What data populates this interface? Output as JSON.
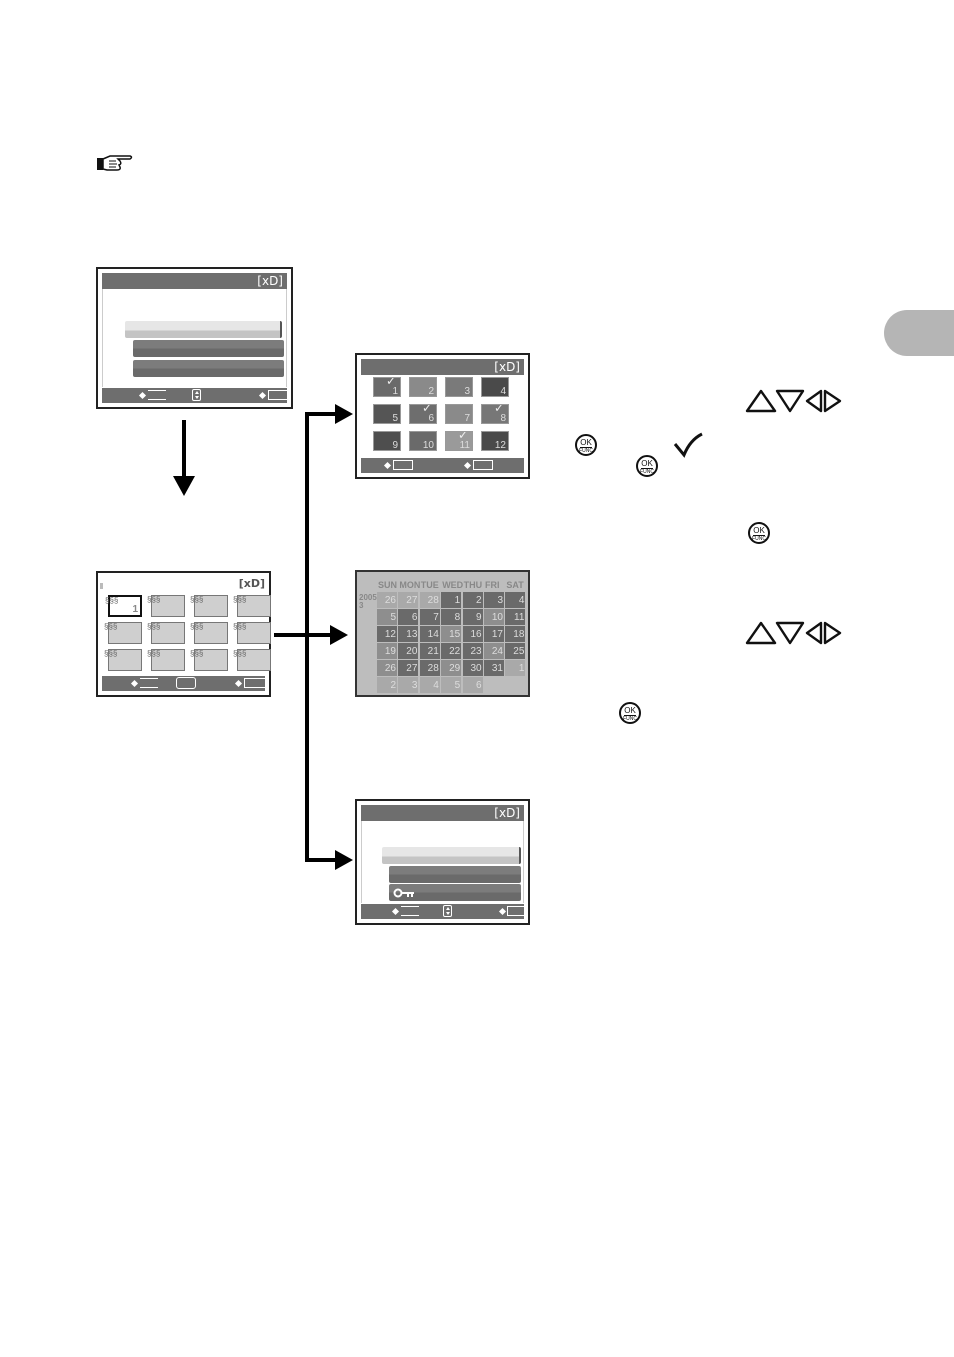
{
  "page": {
    "side_tab": {
      "color": "#b5b5b5"
    },
    "reference_icon": "pointing-hand-icon"
  },
  "screens": {
    "menu_top": {
      "media_label": "[xD]",
      "menu_items": [
        {
          "label": "",
          "state": "selected"
        },
        {
          "label": "",
          "state": "normal"
        },
        {
          "label": "",
          "state": "normal"
        }
      ],
      "footer": {
        "back": "",
        "nav_icon": "up-down-icon",
        "ok": ""
      }
    },
    "album_index": {
      "media_label": "[xD]",
      "albums": [
        {
          "number": "1",
          "selected": true
        },
        {
          "number": "",
          "selected": false
        },
        {
          "number": "",
          "selected": false
        },
        {
          "number": "",
          "selected": false
        },
        {
          "number": "",
          "selected": false
        },
        {
          "number": "",
          "selected": false
        },
        {
          "number": "",
          "selected": false
        },
        {
          "number": "",
          "selected": false
        },
        {
          "number": "",
          "selected": false
        },
        {
          "number": "",
          "selected": false
        },
        {
          "number": "",
          "selected": false
        },
        {
          "number": "",
          "selected": false
        }
      ],
      "footer": {
        "back": "",
        "nav_icon": "four-way-icon",
        "ok": ""
      }
    },
    "thumbnail_select": {
      "media_label": "[xD]",
      "thumbnails": [
        {
          "number": "1",
          "checked": true,
          "tone": "#6a6a6a"
        },
        {
          "number": "2",
          "checked": false,
          "tone": "#8a8a8a"
        },
        {
          "number": "3",
          "checked": false,
          "tone": "#7a7a7a"
        },
        {
          "number": "4",
          "checked": false,
          "tone": "#4a4a4a"
        },
        {
          "number": "5",
          "checked": false,
          "tone": "#555555"
        },
        {
          "number": "6",
          "checked": true,
          "tone": "#6e6e6e"
        },
        {
          "number": "7",
          "checked": false,
          "tone": "#8a8a8a"
        },
        {
          "number": "8",
          "checked": true,
          "tone": "#777777"
        },
        {
          "number": "9",
          "checked": false,
          "tone": "#4e4e4e"
        },
        {
          "number": "10",
          "checked": false,
          "tone": "#6a6a6a"
        },
        {
          "number": "11",
          "checked": true,
          "tone": "#9a9a9a"
        },
        {
          "number": "12",
          "checked": false,
          "tone": "#4a4a4a"
        }
      ],
      "footer": {
        "left": "",
        "right": ""
      }
    },
    "calendar": {
      "year": "2005",
      "month": "3",
      "weekdays": [
        "SUN",
        "MON",
        "TUE",
        "WED",
        "THU",
        "FRI",
        "SAT"
      ],
      "weeks": [
        [
          {
            "d": "26",
            "t": "l"
          },
          {
            "d": "27",
            "t": "l"
          },
          {
            "d": "28",
            "t": "l"
          },
          {
            "d": "1",
            "t": "d"
          },
          {
            "d": "2",
            "t": "d"
          },
          {
            "d": "3",
            "t": "d"
          },
          {
            "d": "4",
            "t": "d"
          }
        ],
        [
          {
            "d": "5",
            "t": "p"
          },
          {
            "d": "6",
            "t": "d"
          },
          {
            "d": "7",
            "t": "d"
          },
          {
            "d": "8",
            "t": "d"
          },
          {
            "d": "9",
            "t": "d"
          },
          {
            "d": "10",
            "t": "p"
          },
          {
            "d": "11",
            "t": "d"
          }
        ],
        [
          {
            "d": "12",
            "t": "d"
          },
          {
            "d": "13",
            "t": "d"
          },
          {
            "d": "14",
            "t": "d"
          },
          {
            "d": "15",
            "t": "p"
          },
          {
            "d": "16",
            "t": "d"
          },
          {
            "d": "17",
            "t": "d"
          },
          {
            "d": "18",
            "t": "d"
          }
        ],
        [
          {
            "d": "19",
            "t": "p"
          },
          {
            "d": "20",
            "t": "d"
          },
          {
            "d": "21",
            "t": "d"
          },
          {
            "d": "22",
            "t": "d"
          },
          {
            "d": "23",
            "t": "d"
          },
          {
            "d": "24",
            "t": "p"
          },
          {
            "d": "25",
            "t": "d"
          }
        ],
        [
          {
            "d": "26",
            "t": "p"
          },
          {
            "d": "27",
            "t": "d"
          },
          {
            "d": "28",
            "t": "d"
          },
          {
            "d": "29",
            "t": "p"
          },
          {
            "d": "30",
            "t": "d"
          },
          {
            "d": "31",
            "t": "d"
          },
          {
            "d": "1",
            "t": "l"
          }
        ],
        [
          {
            "d": "2",
            "t": "l"
          },
          {
            "d": "3",
            "t": "l"
          },
          {
            "d": "4",
            "t": "l"
          },
          {
            "d": "5",
            "t": "l"
          },
          {
            "d": "6",
            "t": "l"
          },
          {
            "d": "",
            "t": "n"
          },
          {
            "d": "",
            "t": "n"
          }
        ]
      ],
      "colors": {
        "light": "#a9a9a9",
        "dark": "#6a6a6a",
        "photo": "#8e8e8e"
      }
    },
    "menu_protect": {
      "media_label": "[xD]",
      "menu_items": [
        {
          "label": "",
          "state": "selected",
          "icon": ""
        },
        {
          "label": "",
          "state": "normal",
          "icon": ""
        },
        {
          "label": "",
          "state": "normal",
          "icon": "key-icon"
        }
      ],
      "footer": {
        "back": "",
        "nav_icon": "up-down-icon",
        "ok": ""
      }
    }
  },
  "instructions": {
    "ok_button": {
      "top_label": "OK",
      "bottom_label": "FUNC"
    },
    "dpad_icon": "up-down-left-right-arrows-icon",
    "check_icon": "✓"
  }
}
